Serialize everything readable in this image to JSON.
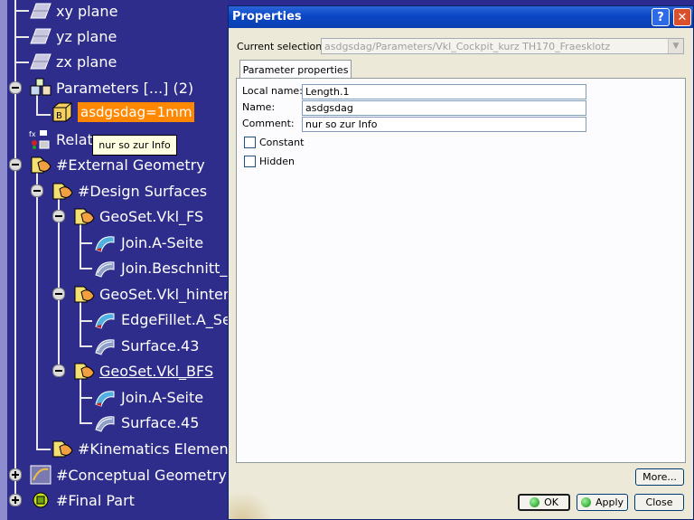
{
  "tree": {
    "items": [
      {
        "label": "xy plane"
      },
      {
        "label": "yz plane"
      },
      {
        "label": "zx plane"
      },
      {
        "label": "Parameters [...] (2)"
      },
      {
        "label": "asdgsdag=1mm"
      },
      {
        "label": "Relat"
      },
      {
        "label": "#External Geometry"
      },
      {
        "label": "#Design Surfaces"
      },
      {
        "label": "GeoSet.Vkl_FS"
      },
      {
        "label": "Join.A-Seite"
      },
      {
        "label": "Join.Beschnitt_z"
      },
      {
        "label": "GeoSet.Vkl_hinten"
      },
      {
        "label": "EdgeFillet.A_Se"
      },
      {
        "label": "Surface.43"
      },
      {
        "label": "GeoSet.Vkl_BFS"
      },
      {
        "label": "Join.A-Seite"
      },
      {
        "label": "Surface.45"
      },
      {
        "label": "#Kinematics Elements"
      },
      {
        "label": "#Conceptual Geometry"
      },
      {
        "label": "#Final Part"
      }
    ],
    "tooltip": "nur so zur Info"
  },
  "dialog": {
    "title": "Properties",
    "help_glyph": "?",
    "close_glyph": "✕",
    "current_selection_label": "Current selection :",
    "current_selection_value": "asdgsdag/Parameters/Vkl_Cockpit_kurz TH170_Fraesklotz",
    "tab_label": "Parameter properties",
    "local_name_label": "Local name:",
    "local_name_value": "Length.1",
    "name_label": "Name:",
    "name_value": "asdgsdag",
    "comment_label": "Comment:",
    "comment_value": "nur so zur Info",
    "constant_label": "Constant",
    "hidden_label": "Hidden",
    "more_label": "More...",
    "ok_label": "OK",
    "apply_label": "Apply",
    "close_label": "Close"
  },
  "colors": {
    "tree_background": "#2e2d8c",
    "selection_highlight": "#ff8800",
    "title_bar": "#0a46c4"
  }
}
